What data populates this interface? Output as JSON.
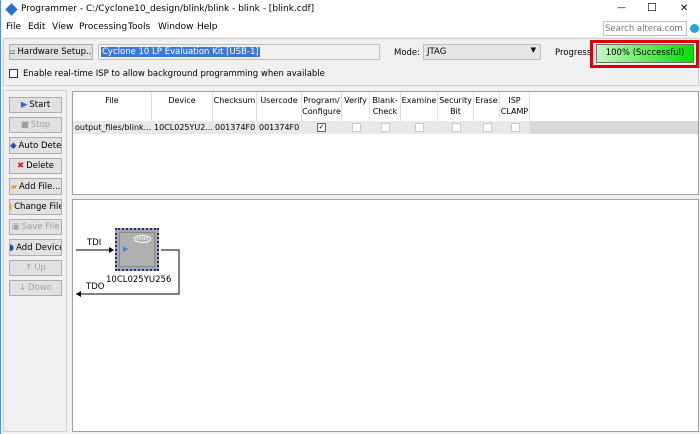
{
  "window": {
    "title": "Programmer - C:/Cyclone10_design/blink/blink - blink - [blink.cdf]",
    "min": "—",
    "max": "☐",
    "close": "✕"
  },
  "menu": [
    "File",
    "Edit",
    "View",
    "Processing",
    "Tools",
    "Window",
    "Help"
  ],
  "search": {
    "placeholder": "Search altera.com"
  },
  "toolbar": {
    "hardware_setup": "Hardware Setup...",
    "hardware": "Cyclone 10 LP Evaluation Kit [USB-1]",
    "mode_label": "Mode:",
    "mode": "JTAG",
    "progress_label": "Progress:",
    "progress_text": "100% (Successful)",
    "progress_value": 100,
    "isp_label": "Enable real-time ISP to allow background programming when available",
    "highlight_color": "#e00000"
  },
  "side_buttons": [
    {
      "label": "Start",
      "enabled": true
    },
    {
      "label": "Stop",
      "enabled": false
    },
    {
      "label": "Auto Detect",
      "enabled": true
    },
    {
      "label": "Delete",
      "enabled": true
    },
    {
      "label": "Add File...",
      "enabled": true
    },
    {
      "label": "Change File",
      "enabled": true
    },
    {
      "label": "Save File",
      "enabled": false
    },
    {
      "label": "Add Device",
      "enabled": true
    },
    {
      "label": "Up",
      "enabled": false
    },
    {
      "label": "Down",
      "enabled": false
    }
  ],
  "table": {
    "headers": [
      "File",
      "Device",
      "Checksum",
      "Usercode",
      "Program/ Configure",
      "Verify",
      "Blank- Check",
      "Examine",
      "Security Bit",
      "Erase",
      "ISP CLAMP"
    ],
    "rows": [
      {
        "file": "output_files/blink...",
        "device": "10CL025YU2...",
        "checksum": "001374F0",
        "usercode": "001374F0",
        "checks": [
          true,
          false,
          false,
          false,
          false,
          false,
          false
        ]
      }
    ]
  },
  "diagram": {
    "tdi": "TDI",
    "tdo": "TDO",
    "device": "10CL025YU256",
    "logo": "intel"
  }
}
